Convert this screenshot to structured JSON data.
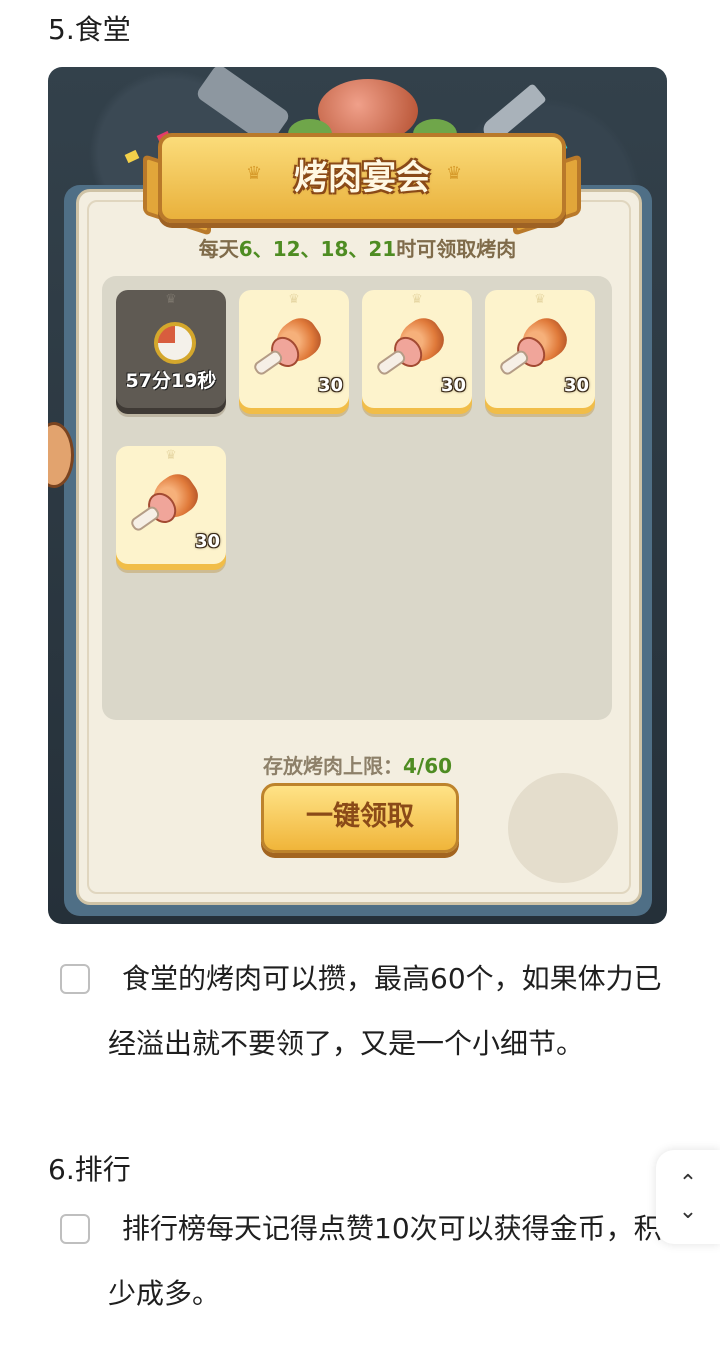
{
  "section5": {
    "title": "5.食堂"
  },
  "game": {
    "banner_title": "烤肉宴会",
    "schedule_prefix": "每天",
    "schedule_times": "6、12、18、21",
    "schedule_suffix": "时可领取烤肉",
    "slots": [
      {
        "type": "timer",
        "text": "57分19秒"
      },
      {
        "type": "meat",
        "qty": "30"
      },
      {
        "type": "meat",
        "qty": "30"
      },
      {
        "type": "meat",
        "qty": "30"
      },
      {
        "type": "meat",
        "qty": "30"
      }
    ],
    "capacity_label": "存放烤肉上限：",
    "capacity_value": "4/60",
    "claim_button": "一键领取"
  },
  "item1": {
    "text": "食堂的烤肉可以攒，最高60个，如果体力已经溢出就不要领了，又是一个小细节。"
  },
  "section6": {
    "title": "6.排行"
  },
  "item2": {
    "text": "排行榜每天记得点赞10次可以获得金币，积少成多。"
  },
  "scroll": {
    "up": "⌃",
    "down": "⌄"
  }
}
